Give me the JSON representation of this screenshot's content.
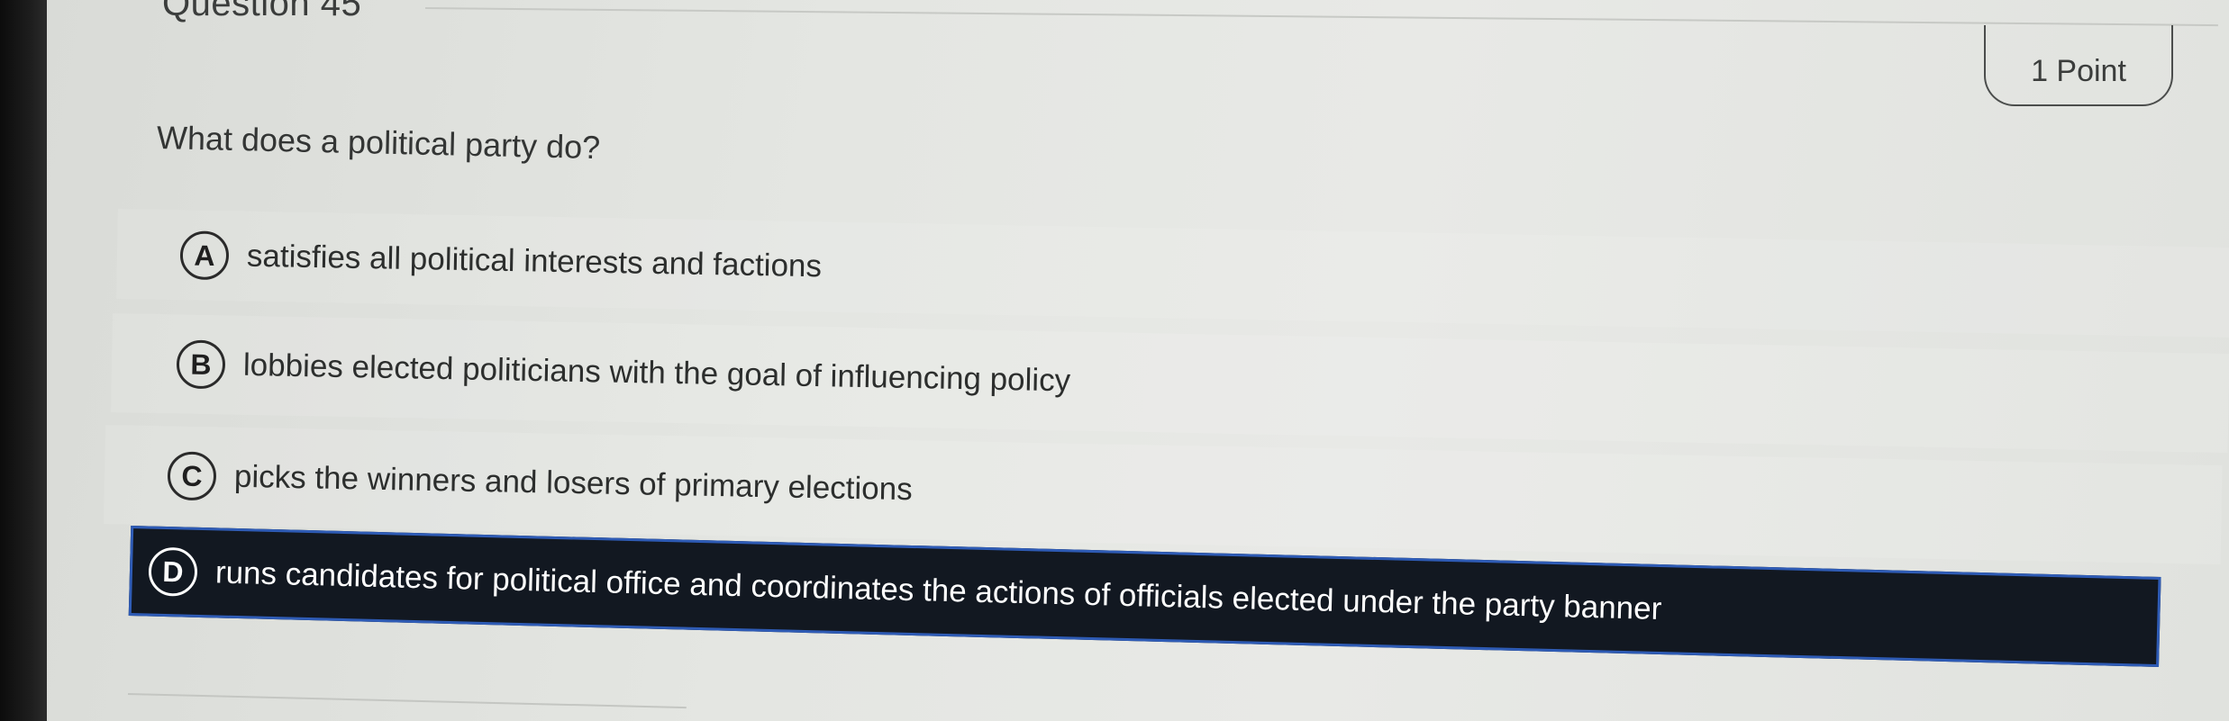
{
  "question": {
    "header": "Question 45",
    "points": "1 Point",
    "prompt": "What does a political party do?"
  },
  "options": [
    {
      "letter": "A",
      "text": "satisfies all political interests and factions",
      "selected": false
    },
    {
      "letter": "B",
      "text": "lobbies elected politicians with the goal of influencing policy",
      "selected": false
    },
    {
      "letter": "C",
      "text": "picks the winners and losers of primary elections",
      "selected": false
    },
    {
      "letter": "D",
      "text": "runs candidates for political office and coordinates the actions of officials elected under the party banner",
      "selected": true
    }
  ],
  "colors": {
    "selected_background": "#121821",
    "selected_border": "#2e5bb5",
    "page_background": "#e4e6e2"
  }
}
